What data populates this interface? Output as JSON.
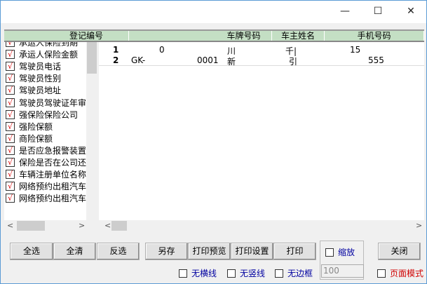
{
  "window": {
    "minimize": "—",
    "maximize": "☐",
    "close": "✕"
  },
  "grid": {
    "headers": [
      "",
      "登记编号",
      "车牌号码",
      "车主姓名",
      "手机号码"
    ],
    "rows": [
      {
        "num": "1",
        "reg_prefix": "",
        "reg_suffix": "0",
        "plate": "川",
        "owner": "千|",
        "phone": "15"
      },
      {
        "num": "2",
        "reg_prefix": "GK-",
        "reg_suffix": "0001",
        "plate": "新",
        "owner": "引",
        "phone": "555"
      }
    ]
  },
  "fields": [
    {
      "label": "承运人保险到期",
      "checked": true
    },
    {
      "label": "承运人保险金额",
      "checked": true
    },
    {
      "label": "驾驶员电话",
      "checked": true
    },
    {
      "label": "驾驶员性别",
      "checked": true
    },
    {
      "label": "驾驶员地址",
      "checked": true
    },
    {
      "label": "驾驶员驾驶证年审",
      "checked": true
    },
    {
      "label": "强保险保险公司",
      "checked": true
    },
    {
      "label": "强险保额",
      "checked": true
    },
    {
      "label": "商险保额",
      "checked": true
    },
    {
      "label": "是否应急报警装置",
      "checked": true
    },
    {
      "label": "保险是否在公司还",
      "checked": true
    },
    {
      "label": "车辆注册单位名称",
      "checked": true
    },
    {
      "label": "网络预约出租汽车",
      "checked": true
    },
    {
      "label": "网络预约出租汽车",
      "checked": true
    }
  ],
  "buttons": {
    "select_all": "全选",
    "clear_all": "全清",
    "invert": "反选",
    "save_as": "另存",
    "print_preview": "打印预览",
    "print_setup": "打印设置",
    "print": "打印",
    "close": "关闭"
  },
  "options": {
    "zoom_label": "缩放",
    "zoom_value": "100",
    "no_hlines": "无横线",
    "no_vlines": "无竖线",
    "no_border": "无边框",
    "page_mode": "页面模式"
  },
  "check_mark": "√"
}
